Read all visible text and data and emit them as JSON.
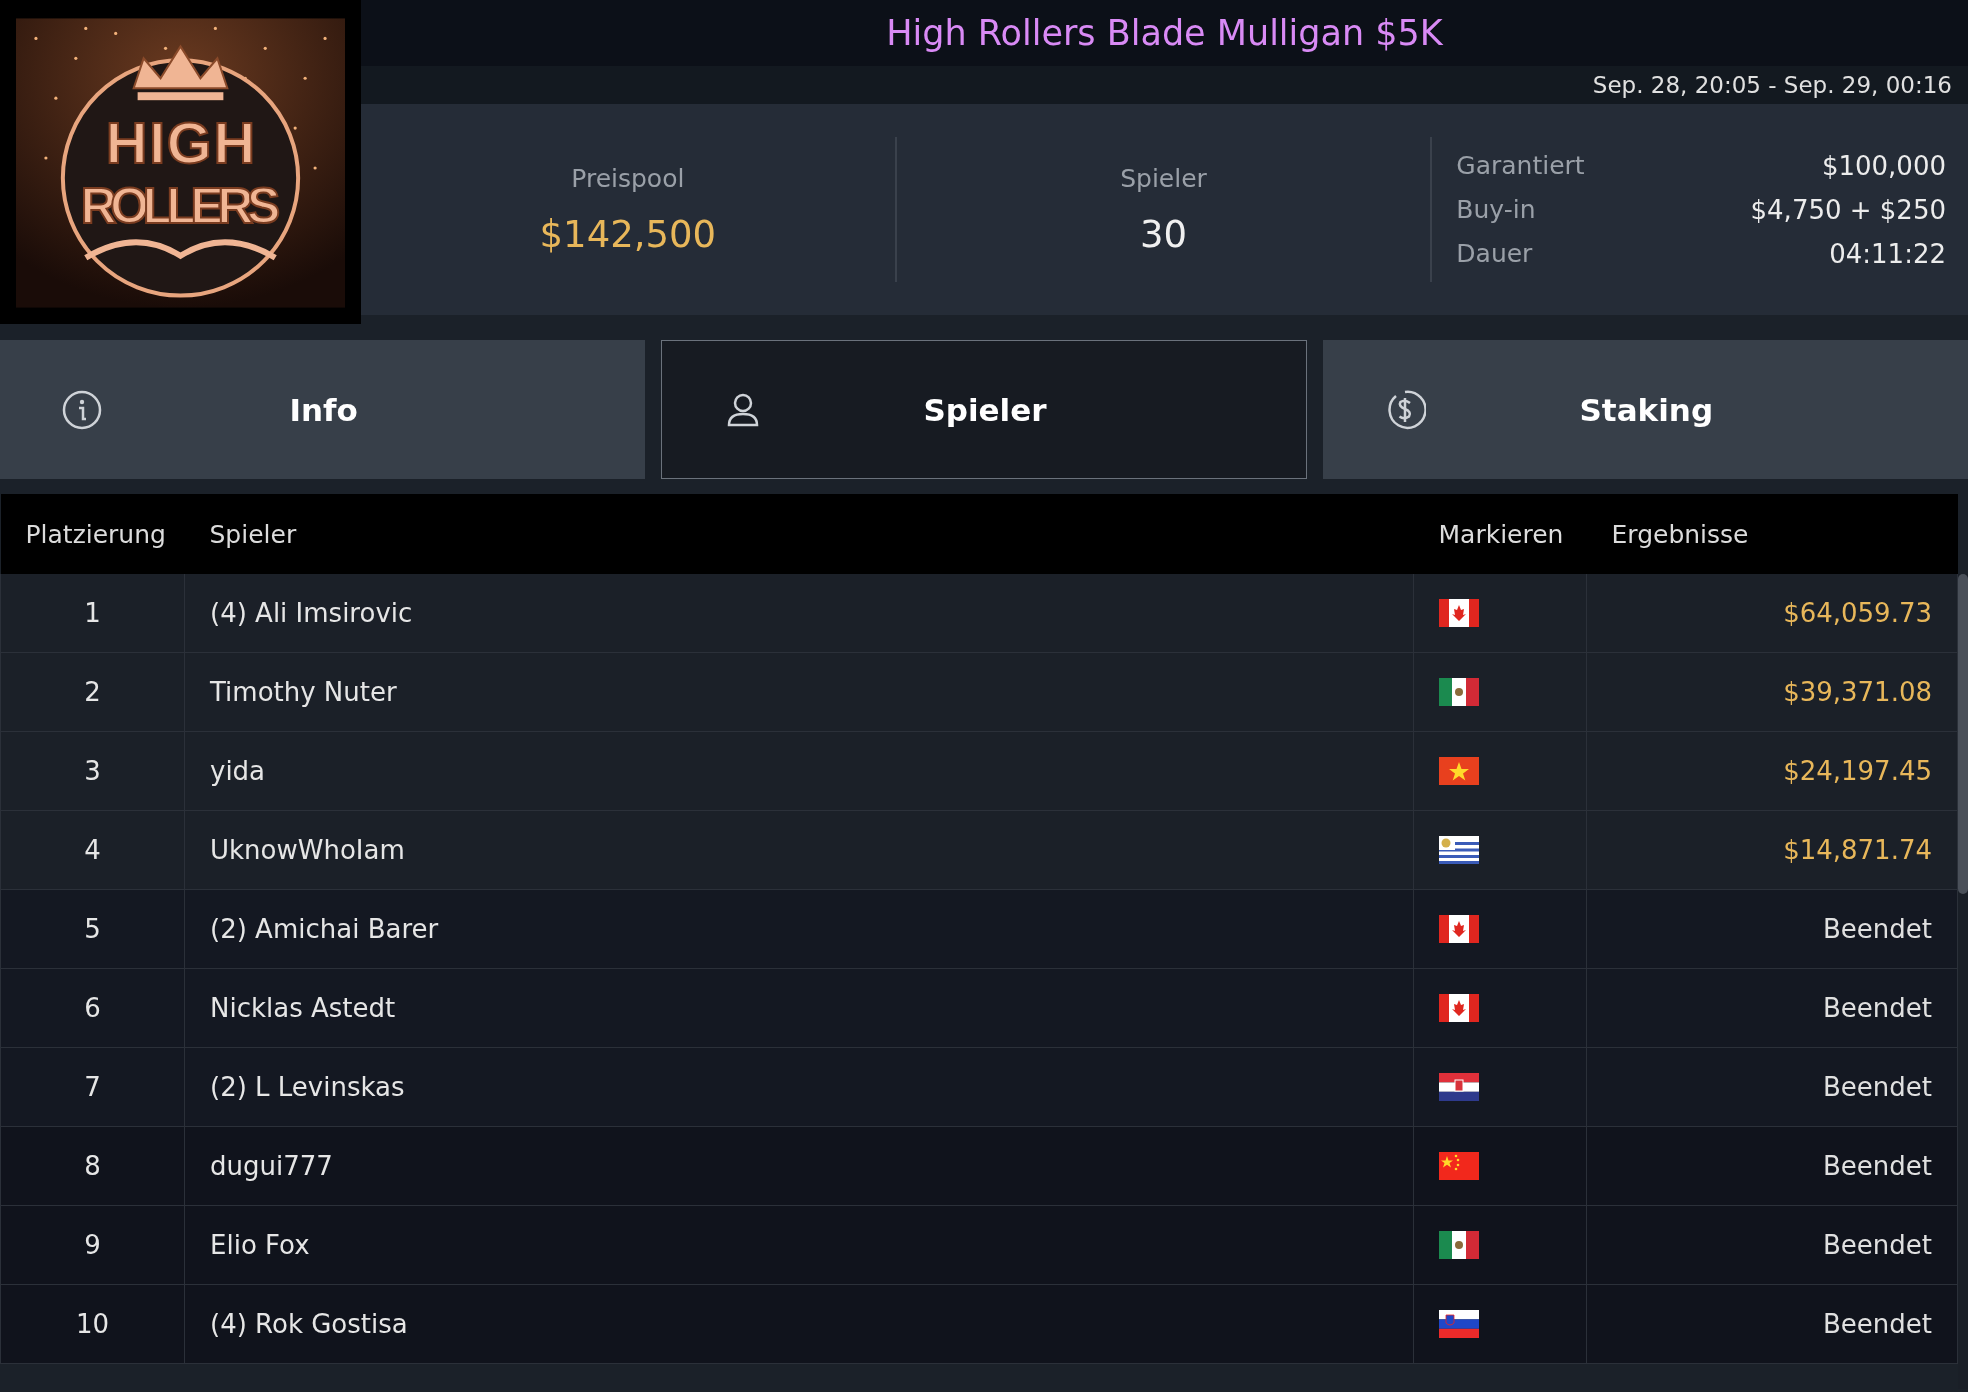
{
  "logo": {
    "lines": [
      "HIGH",
      "ROLLERS"
    ]
  },
  "title": "High Rollers Blade Mulligan $5K",
  "date_range": "Sep. 28, 20:05 - Sep. 29, 00:16",
  "stats": [
    {
      "label": "Preispool",
      "value": "$142,500",
      "kind": "money"
    },
    {
      "label": "Spieler",
      "value": "30",
      "kind": "count"
    }
  ],
  "details": [
    {
      "label": "Garantiert",
      "value": "$100,000"
    },
    {
      "label": "Buy-in",
      "value": "$4,750 + $250"
    },
    {
      "label": "Dauer",
      "value": "04:11:22"
    }
  ],
  "tabs": [
    {
      "label": "Info",
      "kind": "info",
      "selected": false
    },
    {
      "label": "Spieler",
      "kind": "player",
      "selected": true
    },
    {
      "label": "Staking",
      "kind": "staking",
      "selected": false
    }
  ],
  "table": {
    "columns": [
      "Platzierung",
      "Spieler",
      "Markieren",
      "Ergebnisse"
    ],
    "rows": [
      {
        "place": "1",
        "player": "(4) Ali Imsirovic",
        "kind": "canada",
        "result": "$64,059.73",
        "paid": true
      },
      {
        "place": "2",
        "player": "Timothy Nuter",
        "kind": "mexico",
        "result": "$39,371.08",
        "paid": true
      },
      {
        "place": "3",
        "player": "yida",
        "kind": "vietnam",
        "result": "$24,197.45",
        "paid": true
      },
      {
        "place": "4",
        "player": "UknowWhoIam",
        "kind": "uruguay",
        "result": "$14,871.74",
        "paid": true
      },
      {
        "place": "5",
        "player": "(2) Amichai Barer",
        "kind": "canada",
        "result": "Beendet",
        "paid": false
      },
      {
        "place": "6",
        "player": "Nicklas Astedt",
        "kind": "canada",
        "result": "Beendet",
        "paid": false
      },
      {
        "place": "7",
        "player": "(2) L Levinskas",
        "kind": "croatia",
        "result": "Beendet",
        "paid": false
      },
      {
        "place": "8",
        "player": "dugui777",
        "kind": "china",
        "result": "Beendet",
        "paid": false
      },
      {
        "place": "9",
        "player": "Elio Fox",
        "kind": "mexico",
        "result": "Beendet",
        "paid": false
      },
      {
        "place": "10",
        "player": "(4) Rok Gostisa",
        "kind": "slovenia",
        "result": "Beendet",
        "paid": false
      }
    ]
  }
}
